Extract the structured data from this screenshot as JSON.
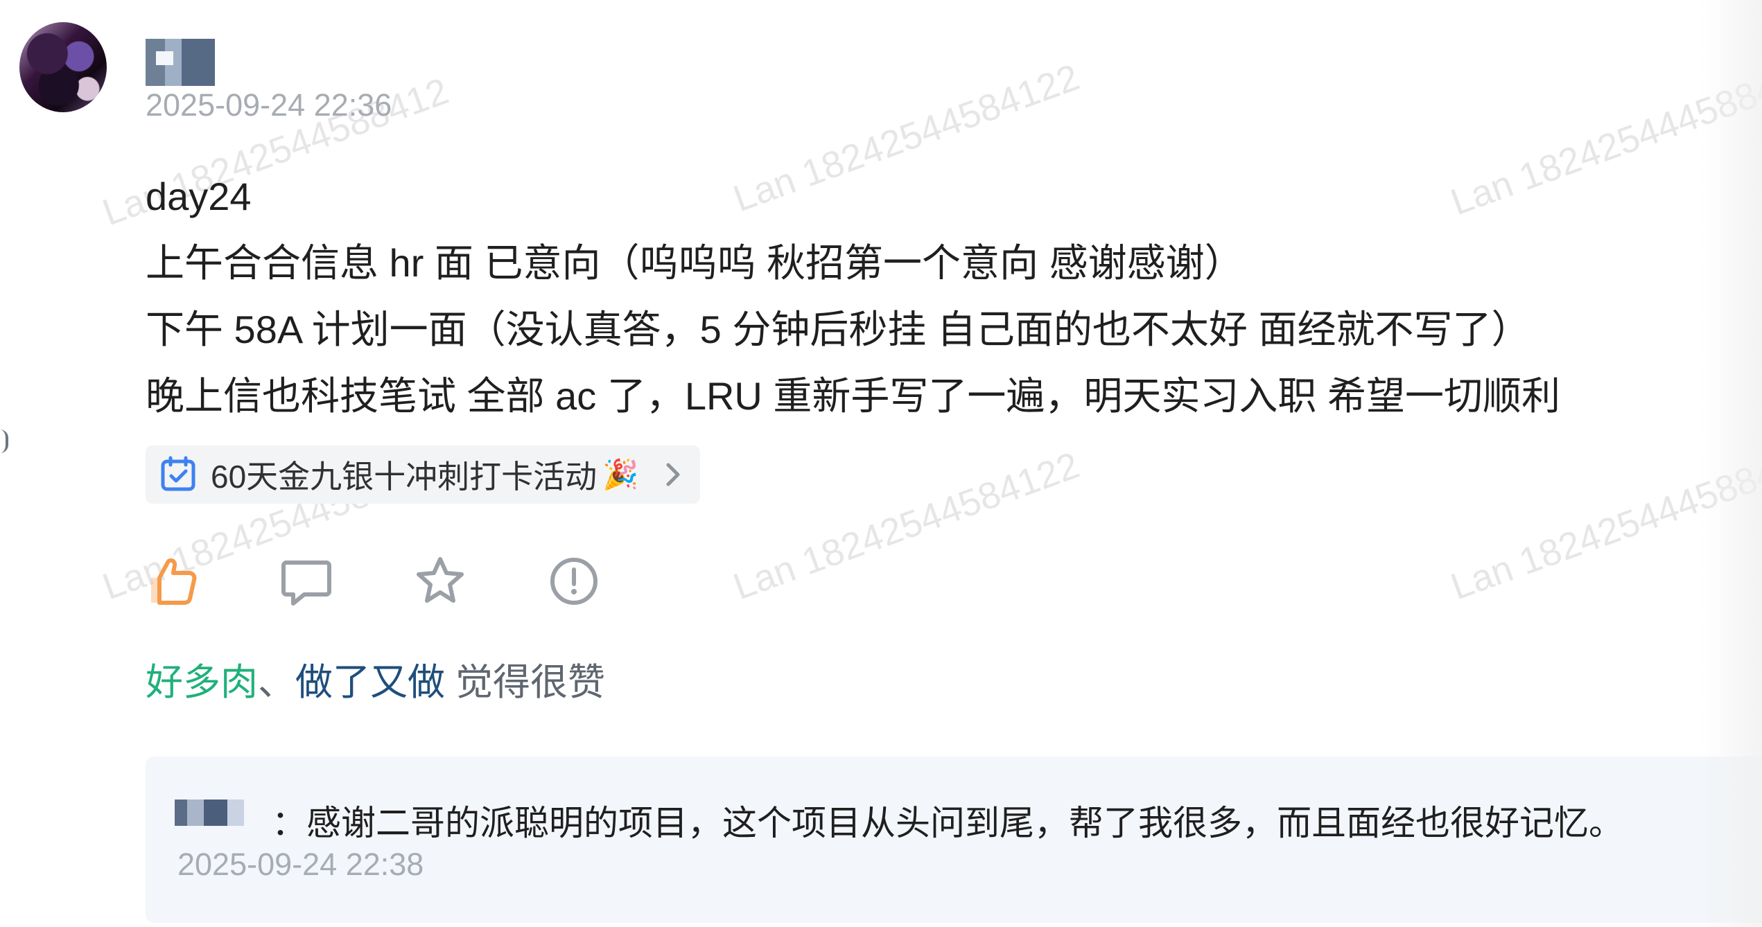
{
  "watermarks": [
    "Lan 18242544588412",
    "Lan 18242544584122",
    "Lan 1824254445884",
    "Lan 1824254458",
    "Lan 18242544584122",
    "Lan 1824254445884"
  ],
  "post": {
    "time": "2025-09-24 22:36",
    "content_lines": [
      "day24",
      "上午合合信息 hr 面 已意向（呜呜呜 秋招第一个意向 感谢感谢）",
      "下午 58A 计划一面（没认真答，5 分钟后秒挂 自己面的也不太好 面经就不写了）",
      "晚上信也科技笔试 全部 ac 了，LRU 重新手写了一遍，明天实习入职 希望一切顺利"
    ],
    "topic": {
      "label": "60天金九银十冲刺打卡活动",
      "emoji": "🎉"
    },
    "likers": {
      "green": "好多肉",
      "separator": "、",
      "blue": "做了又做",
      "tail": " 觉得很赞"
    }
  },
  "comment": {
    "separator": "：",
    "text": "感谢二哥的派聪明的项目，这个项目从头问到尾，帮了我很多，而且面经也很好记忆。",
    "time": "2025-09-24 22:38"
  },
  "icons": {
    "calendar": "calendar-check-icon",
    "chevron": "chevron-right-icon",
    "like": "thumbs-up-icon",
    "comment": "comment-icon",
    "favorite": "star-icon",
    "report": "report-icon"
  },
  "colors": {
    "accent_orange": "#f59a4a",
    "accent_blue": "#3d82f0",
    "green_name": "#20b07b",
    "blue_name": "#1f4e7b"
  }
}
